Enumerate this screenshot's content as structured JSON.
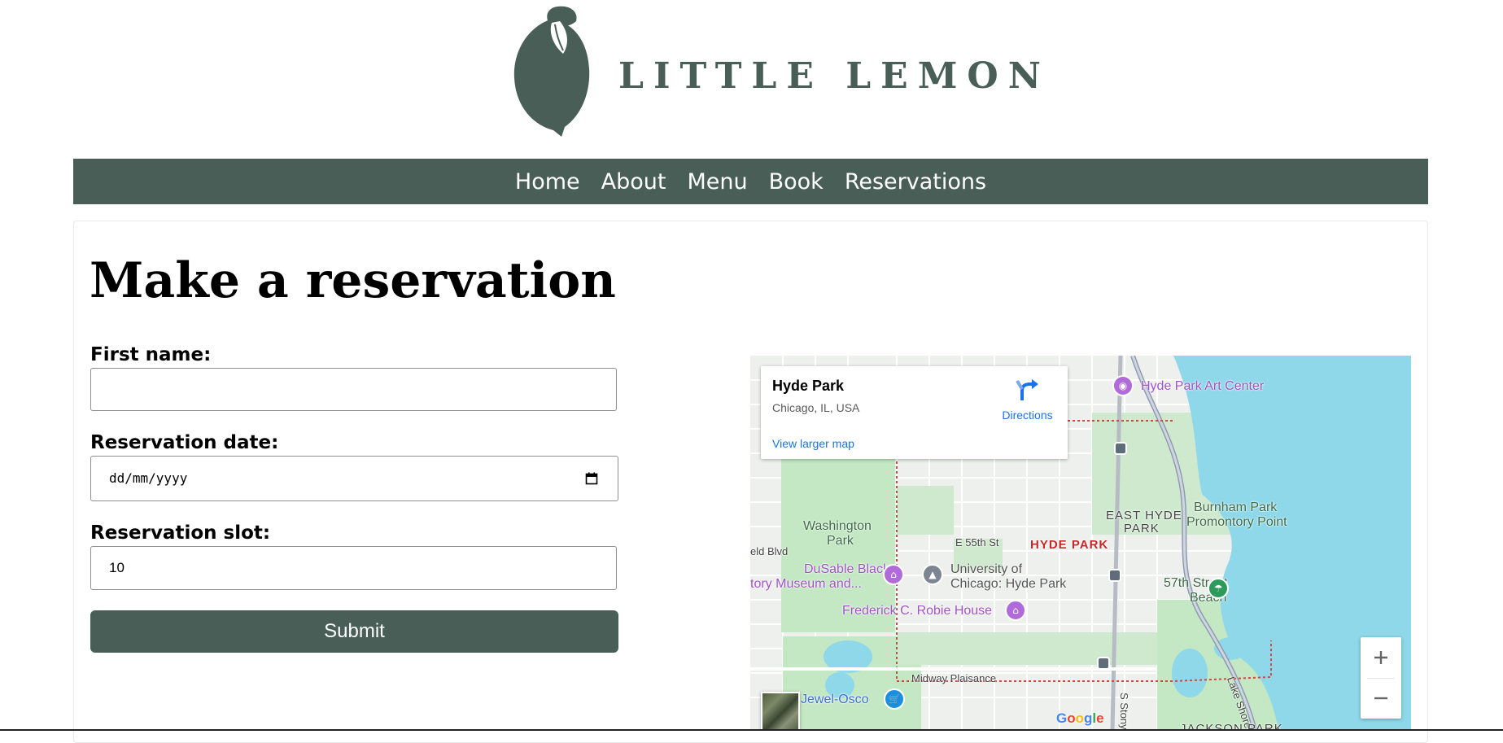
{
  "brand": {
    "name": "LITTLE LEMON",
    "color": "#495e57"
  },
  "nav": {
    "items": [
      "Home",
      "About",
      "Menu",
      "Book",
      "Reservations"
    ]
  },
  "page": {
    "title": "Make a reservation"
  },
  "form": {
    "first_name": {
      "label": "First name:",
      "value": ""
    },
    "reservation_date": {
      "label": "Reservation date:",
      "value": "dd/mm/yyyy"
    },
    "reservation_slot": {
      "label": "Reservation slot:",
      "value": "10"
    },
    "submit_label": "Submit"
  },
  "map": {
    "info_card": {
      "title": "Hyde Park",
      "address": "Chicago, IL, USA",
      "directions_label": "Directions",
      "larger_map_link": "View larger map"
    },
    "labels": {
      "hyde_park_art_center": "Hyde Park Art Center",
      "washington_park_1": "Washington",
      "washington_park_2": "Park",
      "east_hyde_park_1": "EAST HYDE",
      "east_hyde_park_2": "PARK",
      "burnham_1": "Burnham Park",
      "burnham_2": "Promontory Point",
      "e55th": "E 55th St",
      "hyde_park_area": "HYDE PARK",
      "garfield_blvd": "eld Blvd",
      "dusable_1": "DuSable Black",
      "dusable_2": "tory Museum and...",
      "uchicago_1": "University of",
      "uchicago_2": "Chicago: Hyde Park",
      "beach_1": "57th Street",
      "beach_2": "Beach",
      "robie": "Frederick C. Robie House",
      "midway": "Midway Plaisance",
      "jewel": "Jewel-Osco",
      "lake_shore": "Lake Shore Dr",
      "stony": "S Stony",
      "jackson": "JACKSON PARK",
      "google": "Google"
    },
    "colors": {
      "water": "#8ed8ea",
      "park": "#c3e8c3",
      "road": "#ffffff",
      "boundary": "#d84343"
    }
  }
}
